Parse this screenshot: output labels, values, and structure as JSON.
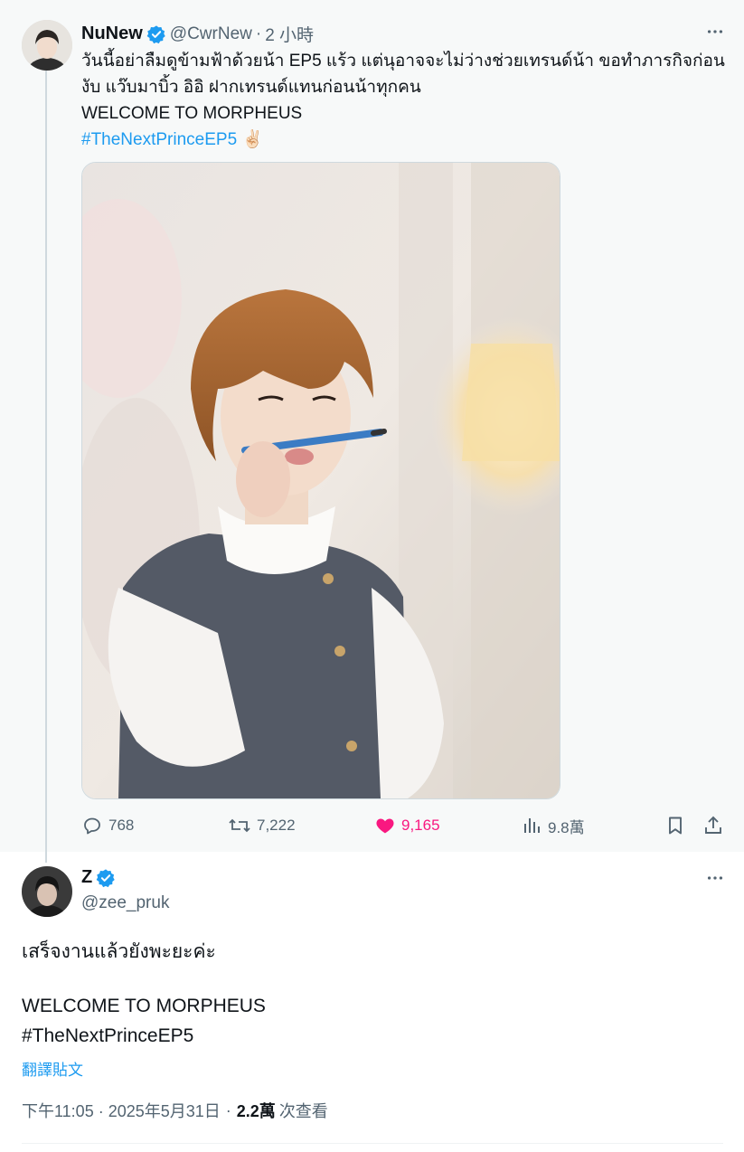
{
  "parent_tweet": {
    "author_name": "NuNew",
    "handle": "@CwrNew",
    "separator": "·",
    "time": "2 小時",
    "text_lines": [
      "วันนี้อย่าลืมดูข้ามฟ้าด้วยน้า EP5 แร้ว แต่นุอาจจะไม่ว่างช่วยเทรนด์น้า ขอทำภารกิจก่อน",
      "งับ แว๊บมาบิ้ว อิอิ ฝากเทรนด์แทนก่อนน้าทุกคน",
      "WELCOME TO MORPHEUS"
    ],
    "hashtag": "#TheNextPrinceEP5",
    "emoji": "✌🏻",
    "stats": {
      "replies": "768",
      "reposts": "7,222",
      "likes": "9,165",
      "views": "9.8萬"
    },
    "colors": {
      "like": "#f91880",
      "link": "#1d9bf0",
      "verified": "#1d9bf0"
    }
  },
  "reply_tweet": {
    "author_name": "Z",
    "handle": "@zee_pruk",
    "text_line_1": "เสร็จงานแล้วยังพะยะค่ะ",
    "text_line_2": "WELCOME TO MORPHEUS",
    "hashtag": "#TheNextPrinceEP5",
    "translate_label": "翻譯貼文",
    "timestamp": "下午11:05 · 2025年5月31日",
    "separator": "·",
    "views_count": "2.2萬",
    "views_label": "次查看"
  },
  "icons": {
    "verified": "verified-badge-icon",
    "more": "more-dots-icon",
    "reply": "reply-bubble-icon",
    "repost": "repost-icon",
    "like": "heart-icon",
    "views": "views-bar-icon",
    "bookmark": "bookmark-icon",
    "share": "share-icon"
  }
}
